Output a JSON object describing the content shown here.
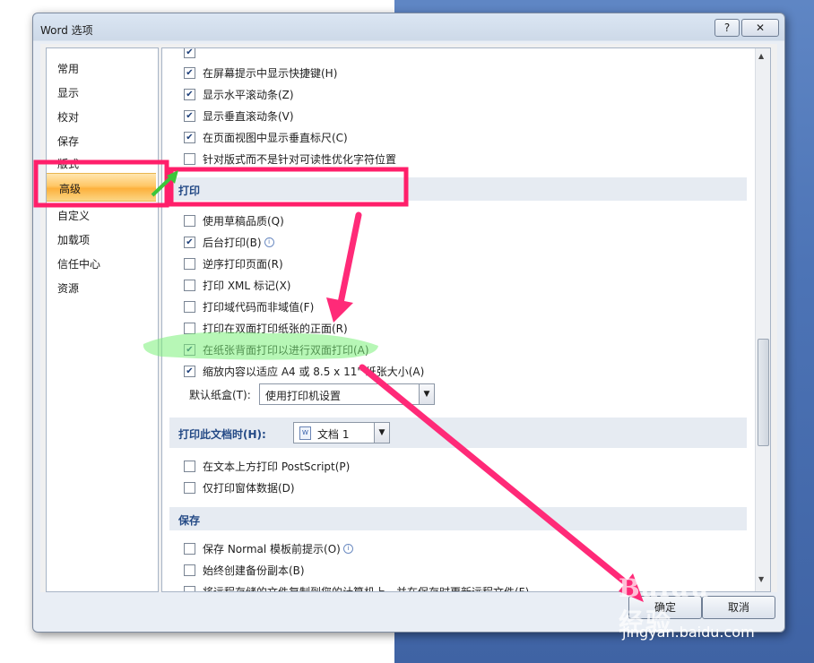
{
  "window": {
    "title": "Word 选项",
    "help_label": "?",
    "close_label": "✕"
  },
  "nav": {
    "items": [
      {
        "label": "常用"
      },
      {
        "label": "显示"
      },
      {
        "label": "校对"
      },
      {
        "label": "保存"
      },
      {
        "label": "版式"
      },
      {
        "label": "高级",
        "selected": true
      },
      {
        "label": "自定义"
      },
      {
        "label": "加载项"
      },
      {
        "label": "信任中心"
      },
      {
        "label": "资源"
      }
    ]
  },
  "display_options": [
    {
      "label": "在屏幕提示中显示快捷键(H)",
      "checked": true
    },
    {
      "label": "显示水平滚动条(Z)",
      "checked": true
    },
    {
      "label": "显示垂直滚动条(V)",
      "checked": true
    },
    {
      "label": "在页面视图中显示垂直标尺(C)",
      "checked": true
    },
    {
      "label": "针对版式而不是针对可读性优化字符位置",
      "checked": false
    }
  ],
  "print_section": {
    "title": "打印",
    "options": [
      {
        "label": "使用草稿品质(Q)",
        "checked": false
      },
      {
        "label": "后台打印(B)",
        "checked": true
      },
      {
        "label": "逆序打印页面(R)",
        "checked": false
      },
      {
        "label": "打印 XML 标记(X)",
        "checked": false
      },
      {
        "label": "打印域代码而非域值(F)",
        "checked": false
      },
      {
        "label": "打印在双面打印纸张的正面(R)",
        "checked": false
      },
      {
        "label": "在纸张背面打印以进行双面打印(A)",
        "checked": true
      },
      {
        "label": "缩放内容以适应 A4 或 8.5 x 11\" 纸张大小(A)",
        "checked": true
      }
    ],
    "tray_label": "默认纸盒(T):",
    "tray_value": "使用打印机设置"
  },
  "print_doc_section": {
    "title": "打印此文档时(H):",
    "doc_value": "文档 1",
    "options": [
      {
        "label": "在文本上方打印 PostScript(P)",
        "checked": false
      },
      {
        "label": "仅打印窗体数据(D)",
        "checked": false
      }
    ]
  },
  "save_section": {
    "title": "保存",
    "options": [
      {
        "label": "保存 Normal 模板前提示(O)",
        "checked": false
      },
      {
        "label": "始终创建备份副本(B)",
        "checked": false
      },
      {
        "label": "将远程存储的文件复制到您的计算机上，并在保存时更新远程文件(F)",
        "checked": false
      }
    ]
  },
  "footer": {
    "ok_label": "确定",
    "cancel_label": "取消"
  },
  "watermark": {
    "logo": "Baidu经验",
    "url": "jingyan.baidu.com"
  },
  "annotation_colors": {
    "highlight_box": "#ff1f6a",
    "arrow_magenta": "#ff2a78",
    "arrow_green": "#3bc63b",
    "marker_green": "#7cf07a"
  }
}
